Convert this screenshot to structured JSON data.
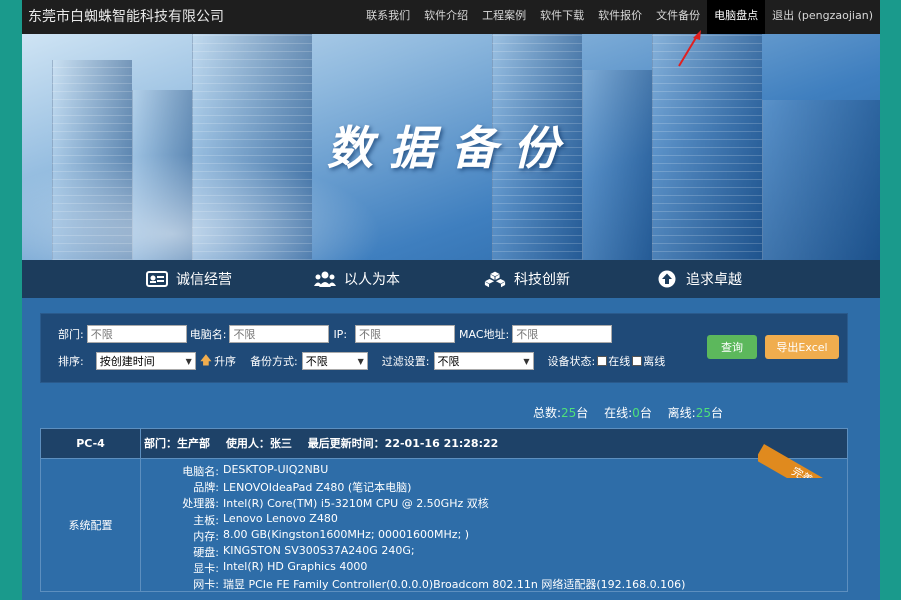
{
  "brand": "东莞市白蜘蛛智能科技有限公司",
  "nav": [
    {
      "label": "联系我们"
    },
    {
      "label": "软件介绍"
    },
    {
      "label": "工程案例"
    },
    {
      "label": "软件下载"
    },
    {
      "label": "软件报价"
    },
    {
      "label": "文件备份"
    },
    {
      "label": "电脑盘点",
      "active": true
    },
    {
      "label": "退出 (pengzaojian)"
    }
  ],
  "banner": {
    "title": "数据备份"
  },
  "features": [
    {
      "label": "诚信经营",
      "icon": "id-card-icon"
    },
    {
      "label": "以人为本",
      "icon": "users-icon"
    },
    {
      "label": "科技创新",
      "icon": "cubes-icon"
    },
    {
      "label": "追求卓越",
      "icon": "arrow-circle-up-icon"
    }
  ],
  "filter": {
    "dept_label": "部门:",
    "dept_placeholder": "不限",
    "pcname_label": "电脑名:",
    "pcname_placeholder": "不限",
    "ip_label": "IP:",
    "ip_placeholder": "不限",
    "mac_label": "MAC地址:",
    "mac_placeholder": "不限",
    "sort_label": "排序:",
    "sort_value": "按创建时间",
    "order_label": "升序",
    "backup_label": "备份方式:",
    "backup_value": "不限",
    "filterset_label": "过滤设置:",
    "filterset_value": "不限",
    "status_label": "设备状态:",
    "online_label": "在线",
    "offline_label": "离线",
    "query_button": "查询",
    "export_button": "导出Excel"
  },
  "summary": {
    "total_label": "总数:",
    "total_value": "25",
    "total_unit": "台",
    "online_label": "在线:",
    "online_value": "0",
    "online_unit": "台",
    "offline_label": "离线:",
    "offline_value": "25",
    "offline_unit": "台"
  },
  "device": {
    "name": "PC-4",
    "dept": "部门：生产部",
    "user": "使用人：张三",
    "updated": "最后更新时间：22-01-16 21:28:22",
    "ribbon": "完善信息",
    "section": "系统配置",
    "specs": [
      {
        "k": "电脑名:",
        "v": "DESKTOP-UIQ2NBU"
      },
      {
        "k": "品牌:",
        "v": "LENOVOIdeaPad Z480 (笔记本电脑)"
      },
      {
        "k": "处理器:",
        "v": "Intel(R) Core(TM) i5-3210M CPU @ 2.50GHz 双核"
      },
      {
        "k": "主板:",
        "v": "Lenovo Lenovo Z480"
      },
      {
        "k": "内存:",
        "v": "8.00 GB(Kingston1600MHz; 00001600MHz; )"
      },
      {
        "k": "硬盘:",
        "v": "KINGSTON SV300S37A240G 240G;"
      },
      {
        "k": "显卡:",
        "v": "Intel(R) HD Graphics 4000"
      },
      {
        "k": "网卡:",
        "v": "瑞昱 PCIe FE Family Controller(0.0.0.0)Broadcom 802.11n 网络适配器(192.168.0.106)"
      }
    ]
  },
  "colors": {
    "accent_green": "#4ee07a",
    "ribbon": "#e08a1e",
    "nav_bg": "#1e1e1e",
    "panel": "#2e6da8"
  }
}
